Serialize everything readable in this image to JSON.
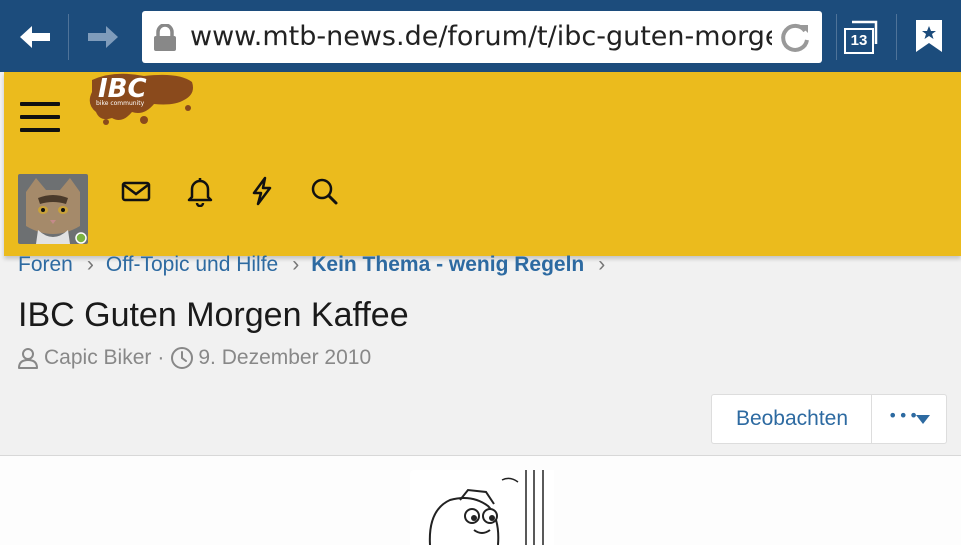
{
  "browser": {
    "url": "www.mtb-news.de/forum/t/ibc-guten-morgen-kaffee",
    "tab_count": "13"
  },
  "site": {
    "logo_text": "IBC",
    "logo_tagline": "bike community",
    "brand_color": "#ebbb1d",
    "link_color": "#2d6aa1"
  },
  "breadcrumb": {
    "items": [
      "Foren",
      "Off-Topic und Hilfe",
      "Kein Thema - wenig Regeln"
    ]
  },
  "thread": {
    "title": "IBC Guten Morgen Kaffee",
    "author": "Capic Biker",
    "separator": "·",
    "date": "9. Dezember 2010"
  },
  "actions": {
    "watch_label": "Beobachten",
    "more_label": "•••"
  },
  "icons": {
    "back": "back-arrow-icon",
    "forward": "forward-arrow-icon",
    "lock": "lock-icon",
    "reload": "reload-icon",
    "tabs": "tabs-icon",
    "bookmark": "bookmark-icon",
    "menu": "hamburger-menu-icon",
    "mail": "mail-icon",
    "bell": "bell-icon",
    "bolt": "lightning-icon",
    "search": "search-icon",
    "user": "user-icon",
    "clock": "clock-icon"
  }
}
